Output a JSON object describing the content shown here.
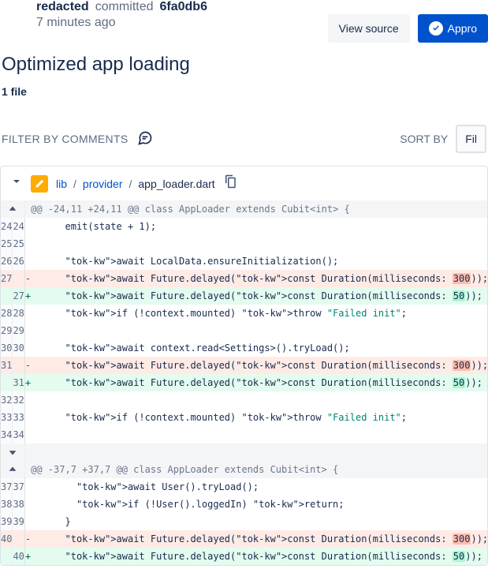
{
  "header": {
    "author": "redacted",
    "verb": "committed",
    "hash": "6fa0db6",
    "time": "7 minutes ago"
  },
  "actions": {
    "viewSource": "View source",
    "approve": "Appro"
  },
  "title": "Optimized app loading",
  "fileCount": "1 file",
  "toolbar": {
    "filterLabel": "FILTER BY COMMENTS",
    "sortLabel": "SORT BY",
    "sortValue": "Fil"
  },
  "file": {
    "segments": [
      "lib",
      "provider"
    ],
    "name": "app_loader.dart"
  },
  "hunks": [
    {
      "header": "@@ -24,11 +24,11 @@ class AppLoader extends Cubit<int> {",
      "lines": [
        {
          "o": "24",
          "n": "24",
          "t": "ctx",
          "i": "      emit(state + 1);"
        },
        {
          "o": "25",
          "n": "25",
          "t": "ctx",
          "i": ""
        },
        {
          "o": "26",
          "n": "26",
          "t": "ctx",
          "i": "      await LocalData.ensureInitialization();"
        },
        {
          "o": "27",
          "n": "",
          "t": "del",
          "i": "      await Future.delayed(const Duration(milliseconds: ",
          "num": "300",
          "post": "));"
        },
        {
          "o": "",
          "n": "27",
          "t": "add",
          "i": "      await Future.delayed(const Duration(milliseconds: ",
          "num": "50",
          "post": "));"
        },
        {
          "o": "28",
          "n": "28",
          "t": "ctx",
          "i": "      if (!context.mounted) throw \"Failed init\";"
        },
        {
          "o": "29",
          "n": "29",
          "t": "ctx",
          "i": ""
        },
        {
          "o": "30",
          "n": "30",
          "t": "ctx",
          "i": "      await context.read<Settings>().tryLoad();"
        },
        {
          "o": "31",
          "n": "",
          "t": "del",
          "i": "      await Future.delayed(const Duration(milliseconds: ",
          "num": "300",
          "post": "));"
        },
        {
          "o": "",
          "n": "31",
          "t": "add",
          "i": "      await Future.delayed(const Duration(milliseconds: ",
          "num": "50",
          "post": "));"
        },
        {
          "o": "32",
          "n": "32",
          "t": "ctx",
          "i": ""
        },
        {
          "o": "33",
          "n": "33",
          "t": "ctx",
          "i": "      if (!context.mounted) throw \"Failed init\";"
        },
        {
          "o": "34",
          "n": "34",
          "t": "ctx",
          "i": ""
        }
      ]
    },
    {
      "header": "@@ -37,7 +37,7 @@ class AppLoader extends Cubit<int> {",
      "lines": [
        {
          "o": "37",
          "n": "37",
          "t": "ctx",
          "i": "        await User().tryLoad();"
        },
        {
          "o": "38",
          "n": "38",
          "t": "ctx",
          "i": "        if (!User().loggedIn) return;"
        },
        {
          "o": "39",
          "n": "39",
          "t": "ctx",
          "i": "      }"
        },
        {
          "o": "40",
          "n": "",
          "t": "del",
          "i": "      await Future.delayed(const Duration(milliseconds: ",
          "num": "300",
          "post": "));"
        },
        {
          "o": "",
          "n": "40",
          "t": "add",
          "i": "      await Future.delayed(const Duration(milliseconds: ",
          "num": "50",
          "post": "));"
        }
      ]
    }
  ]
}
